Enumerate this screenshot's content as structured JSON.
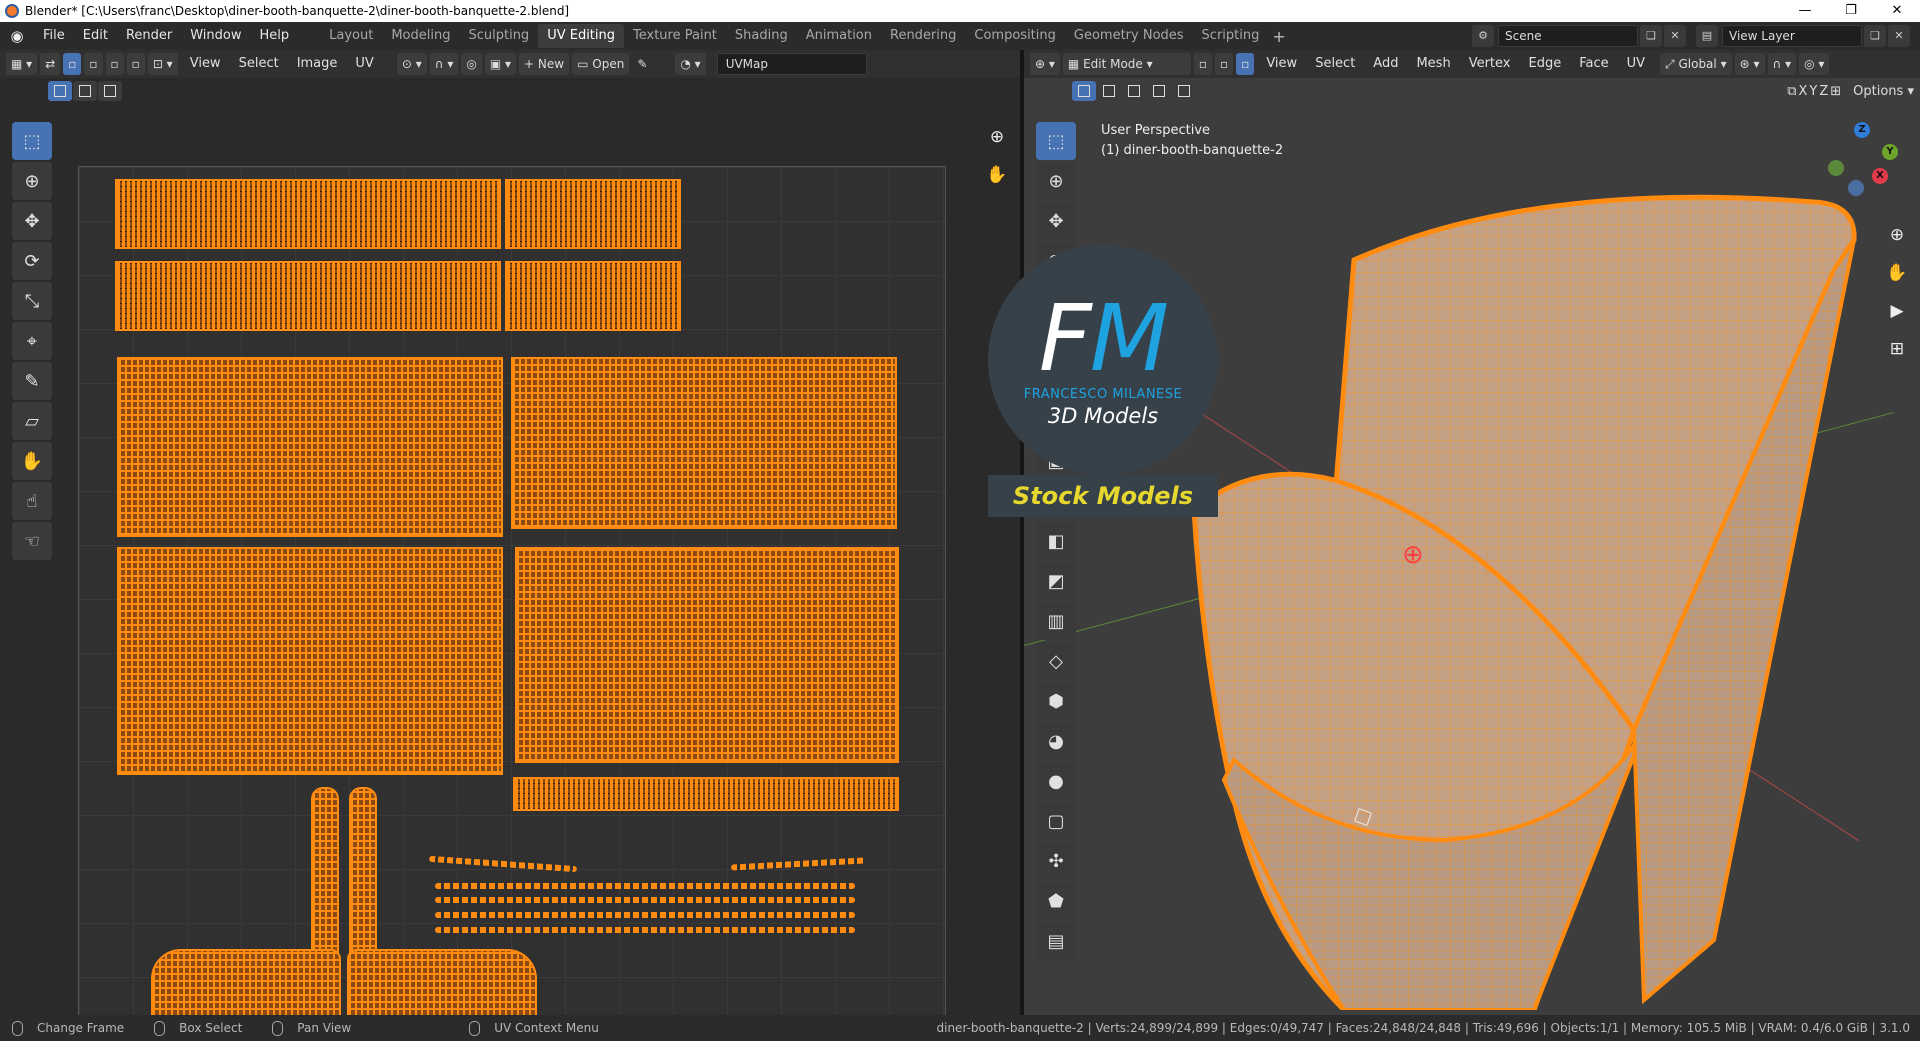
{
  "window": {
    "title": "Blender* [C:\\Users\\franc\\Desktop\\diner-booth-banquette-2\\diner-booth-banquette-2.blend]",
    "controls": [
      "—",
      "❐",
      "✕"
    ]
  },
  "menubar": {
    "items": [
      "File",
      "Edit",
      "Render",
      "Window",
      "Help"
    ]
  },
  "workspaces": {
    "tabs": [
      "Layout",
      "Modeling",
      "Sculpting",
      "UV Editing",
      "Texture Paint",
      "Shading",
      "Animation",
      "Rendering",
      "Compositing",
      "Geometry Nodes",
      "Scripting"
    ],
    "active": "UV Editing",
    "add": "+"
  },
  "scene": {
    "name": "Scene",
    "view_layer": "View Layer"
  },
  "uv_editor": {
    "menus": [
      "View",
      "Select",
      "Image",
      "UV"
    ],
    "new_label": "New",
    "open_label": "Open",
    "uvmap": "UVMap"
  },
  "viewport": {
    "mode": "Edit Mode",
    "menus": [
      "View",
      "Select",
      "Add",
      "Mesh",
      "Vertex",
      "Edge",
      "Face",
      "UV"
    ],
    "orientation": "Global",
    "axes": [
      "X",
      "Y",
      "Z"
    ],
    "options_label": "Options",
    "perspective": "User Perspective",
    "object_label": "(1) diner-booth-banquette-2"
  },
  "logo": {
    "f": "F",
    "m": "M",
    "name": "FRANCESCO MILANESE",
    "subtitle": "3D Models",
    "stock": "Stock Models"
  },
  "statusbar": {
    "items": [
      "Change Frame",
      "Box Select",
      "Pan View",
      "UV Context Menu"
    ],
    "stats": "diner-booth-banquette-2 | Verts:24,899/24,899 | Edges:0/49,747 | Faces:24,848/24,848 | Tris:49,696 | Objects:1/1 | Memory: 105.5 MiB | VRAM: 0.4/6.0 GiB | 3.1.0"
  },
  "colors": {
    "accent": "#4772b3",
    "uv_orange": "#ff8c10",
    "logo_blue": "#1ea2e0",
    "logo_yellow": "#e6d82e"
  }
}
